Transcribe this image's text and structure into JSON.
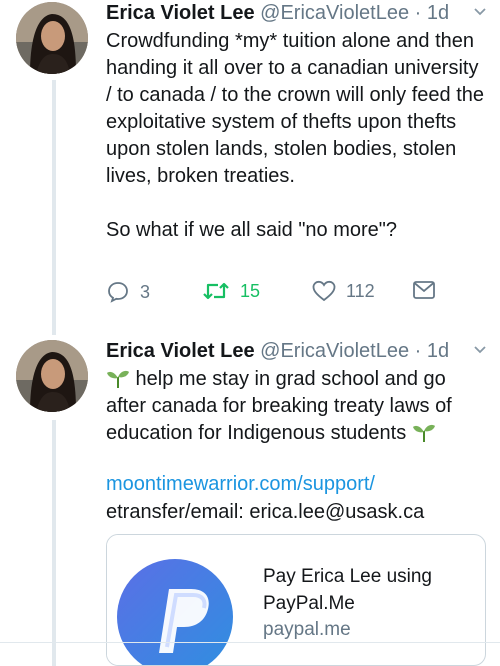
{
  "tweets": [
    {
      "name": "Erica Violet Lee",
      "handle": "@EricaVioletLee",
      "sep": "·",
      "time": "1d",
      "text": "Crowdfunding *my* tuition alone and then handing it all over to a canadian university / to canada / to the crown will only feed the exploitative system of thefts upon thefts upon stolen lands, stolen bodies, stolen lives, broken treaties.\n\nSo what if we all said \"no more\"?",
      "replies": "3",
      "retweets": "15",
      "likes": "112"
    },
    {
      "name": "Erica Violet Lee",
      "handle": "@EricaVioletLee",
      "sep": "·",
      "time": "1d",
      "text": " help me stay in grad school and go after canada for breaking treaty laws of education for Indigenous students ",
      "link": "moontimewarrior.com/support/",
      "etransfer": "etransfer/email: erica.lee@usask.ca",
      "card": {
        "title": "Pay Erica Lee using PayPal.Me",
        "url": "paypal.me"
      }
    }
  ],
  "colors": {
    "accent": "#1b95e0",
    "retweet": "#17bf63",
    "muted": "#657786"
  },
  "icons": [
    "seedling-icon",
    "reply-icon",
    "retweet-icon",
    "like-icon",
    "dm-icon",
    "chevron-down-icon",
    "paypal-logo"
  ]
}
